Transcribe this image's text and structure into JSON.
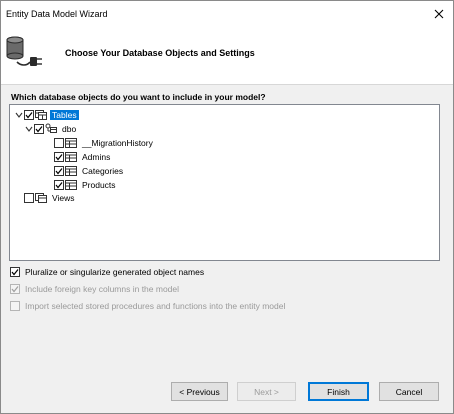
{
  "window": {
    "title": "Entity Data Model Wizard",
    "close_icon": "close-icon"
  },
  "header": {
    "title": "Choose Your Database Objects and Settings",
    "icon": "database-connector-icon"
  },
  "question": "Which database objects do you want to include in your model?",
  "tree": {
    "tables": {
      "label": "Tables",
      "checked": true,
      "expanded": true,
      "selected": true
    },
    "dbo": {
      "label": "dbo",
      "checked": true,
      "expanded": true
    },
    "items": [
      {
        "label": "__MigrationHistory",
        "checked": false
      },
      {
        "label": "Admins",
        "checked": true
      },
      {
        "label": "Categories",
        "checked": true
      },
      {
        "label": "Products",
        "checked": true
      }
    ],
    "views": {
      "label": "Views",
      "checked": false
    }
  },
  "options": {
    "pluralize": {
      "label": "Pluralize or singularize generated object names",
      "checked": true,
      "enabled": true
    },
    "foreign_keys": {
      "label": "Include foreign key columns in the model",
      "checked": true,
      "enabled": false
    },
    "import_procs": {
      "label": "Import selected stored procedures and functions into the entity model",
      "checked": false,
      "enabled": false
    }
  },
  "buttons": {
    "previous": "< Previous",
    "next": "Next >",
    "finish": "Finish",
    "cancel": "Cancel"
  },
  "colors": {
    "selection": "#0078d7",
    "button_face": "#e1e1e1",
    "dialog_bg": "#f0f0f0"
  }
}
